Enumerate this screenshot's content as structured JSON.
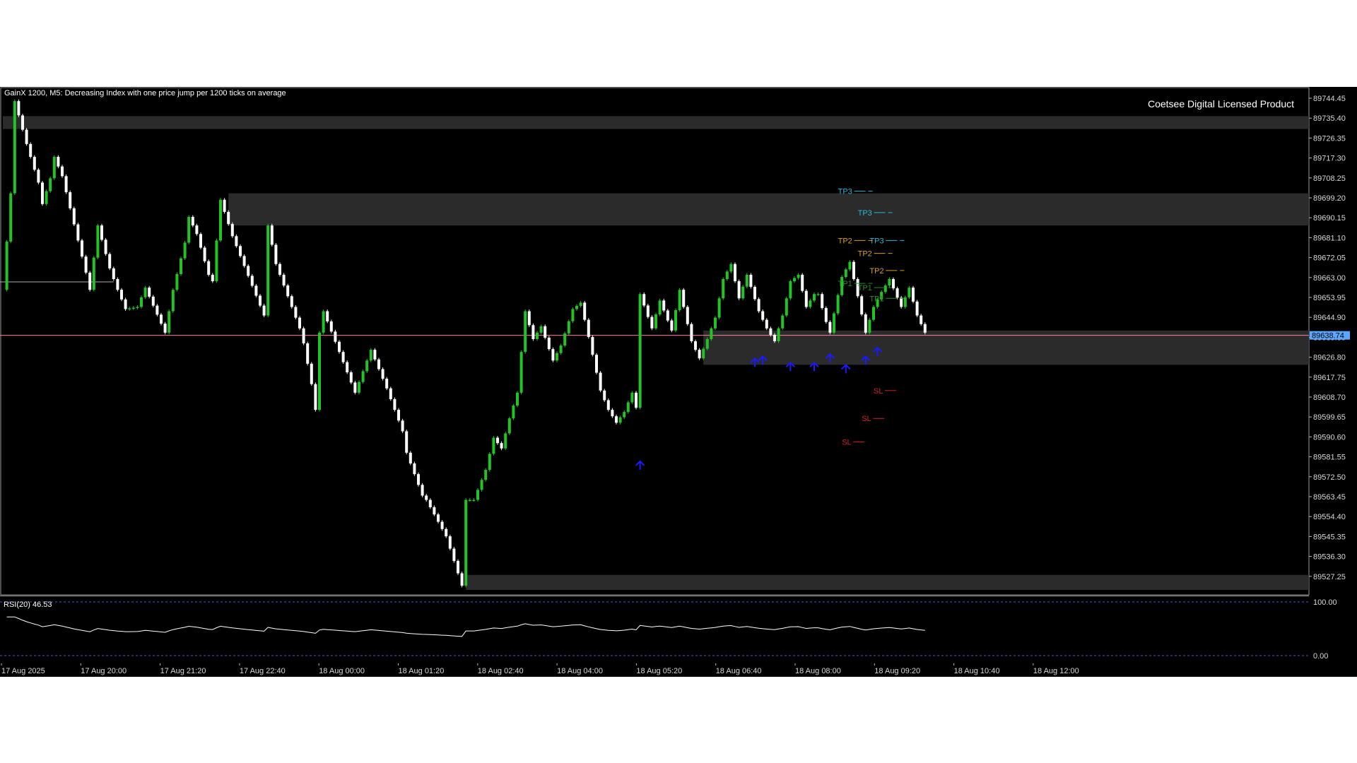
{
  "window": {
    "title": "GainX 1200, M5:  Decreasing Index with one price jump per 1200 ticks on average",
    "watermark": "Coetsee Digital Licensed Product"
  },
  "colors": {
    "background": "#000000",
    "bull_candle": "#22c322",
    "bear_candle": "#ffffff",
    "bid_line": "#ff7f9f",
    "price_tag": "#5aa7ff",
    "zone_fill": "#303030",
    "arrow": "#1a1aff",
    "tp3": "#27b9d8",
    "tp2": "#d9a020",
    "tp1": "#2a8a2a",
    "sl": "#d02020",
    "rsi_line": "#ffffff",
    "rsi_level": "#3f5fc8"
  },
  "price_axis": {
    "labels": [
      "89744.45",
      "89735.40",
      "89726.35",
      "89717.30",
      "89708.25",
      "89699.20",
      "89690.15",
      "89681.10",
      "89672.05",
      "89663.00",
      "89653.95",
      "89644.90",
      "89635.85",
      "89626.80",
      "89617.75",
      "89608.70",
      "89599.65",
      "89590.60",
      "89581.55",
      "89572.50",
      "89563.45",
      "89554.40",
      "89545.35",
      "89536.30",
      "89527.25"
    ],
    "current_price": "89638.74"
  },
  "rsi": {
    "title": "RSI(20) 46.53",
    "levels": [
      "100.00",
      "0.00"
    ]
  },
  "time_axis": {
    "labels": [
      "17 Aug 2025",
      "17 Aug 20:00",
      "17 Aug 21:20",
      "17 Aug 22:40",
      "18 Aug 00:00",
      "18 Aug 01:20",
      "18 Aug 02:40",
      "18 Aug 04:00",
      "18 Aug 05:20",
      "18 Aug 06:40",
      "18 Aug 08:00",
      "18 Aug 09:20",
      "18 Aug 10:40",
      "18 Aug 12:00"
    ]
  },
  "chart_data": {
    "type": "candlestick",
    "symbol": "GainX 1200",
    "timeframe": "M5",
    "price_range": [
      89520,
      89752
    ],
    "candle_count": 158,
    "anchors": [
      [
        0,
        89660
      ],
      [
        2,
        89705
      ],
      [
        3,
        89748
      ],
      [
        6,
        89728
      ],
      [
        9,
        89710
      ],
      [
        10,
        89700
      ],
      [
        12,
        89712
      ],
      [
        13,
        89722
      ],
      [
        15,
        89713
      ],
      [
        21,
        89668
      ],
      [
        22,
        89660
      ],
      [
        24,
        89690
      ],
      [
        27,
        89670
      ],
      [
        29,
        89660
      ],
      [
        31,
        89651
      ],
      [
        34,
        89652
      ],
      [
        36,
        89661
      ],
      [
        41,
        89640
      ],
      [
        43,
        89660
      ],
      [
        46,
        89682
      ],
      [
        47,
        89694
      ],
      [
        49,
        89686
      ],
      [
        52,
        89667
      ],
      [
        53,
        89664
      ],
      [
        55,
        89702
      ],
      [
        58,
        89685
      ],
      [
        66,
        89648
      ],
      [
        67,
        89690
      ],
      [
        69,
        89672
      ],
      [
        75,
        89642
      ],
      [
        76,
        89635
      ],
      [
        78,
        89616
      ],
      [
        79,
        89604
      ],
      [
        80,
        89640
      ],
      [
        81,
        89650
      ],
      [
        89,
        89612
      ],
      [
        93,
        89632
      ],
      [
        97,
        89614
      ],
      [
        101,
        89594
      ],
      [
        102,
        89584
      ],
      [
        106,
        89564
      ],
      [
        107,
        89562
      ],
      [
        112,
        89545
      ],
      [
        116,
        89522
      ],
      [
        117,
        89562
      ],
      [
        119,
        89562
      ],
      [
        122,
        89576
      ],
      [
        124,
        89591
      ],
      [
        126,
        89586
      ],
      [
        128,
        89600
      ],
      [
        130,
        89612
      ],
      [
        132,
        89650
      ],
      [
        134,
        89637
      ],
      [
        136,
        89643
      ],
      [
        139,
        89627
      ],
      [
        141,
        89634
      ],
      [
        144,
        89651
      ],
      [
        146,
        89654
      ],
      [
        148,
        89638
      ],
      [
        151,
        89613
      ],
      [
        153,
        89604
      ],
      [
        155,
        89598
      ],
      [
        157,
        89603
      ],
      [
        159,
        89612
      ],
      [
        160,
        89605
      ],
      [
        161,
        89658
      ],
      [
        164,
        89642
      ],
      [
        166,
        89655
      ],
      [
        169,
        89641
      ],
      [
        171,
        89660
      ],
      [
        174,
        89636
      ],
      [
        176,
        89628
      ],
      [
        178,
        89637
      ],
      [
        180,
        89647
      ],
      [
        182,
        89665
      ],
      [
        184,
        89672
      ],
      [
        186,
        89656
      ],
      [
        188,
        89667
      ],
      [
        191,
        89650
      ],
      [
        193,
        89642
      ],
      [
        195,
        89636
      ],
      [
        197,
        89648
      ],
      [
        199,
        89664
      ],
      [
        201,
        89667
      ],
      [
        203,
        89652
      ],
      [
        205,
        89658
      ],
      [
        206,
        89658
      ],
      [
        208,
        89645
      ],
      [
        209,
        89640
      ],
      [
        210,
        89649
      ],
      [
        212,
        89666
      ],
      [
        214,
        89673
      ],
      [
        216,
        89657
      ],
      [
        218,
        89640
      ],
      [
        220,
        89652
      ],
      [
        222,
        89659
      ],
      [
        224,
        89665
      ],
      [
        227,
        89652
      ],
      [
        229,
        89661
      ],
      [
        231,
        89648
      ],
      [
        233,
        89640
      ]
    ],
    "zones": [
      {
        "from_index": 0,
        "price_top": 89741,
        "price_bottom": 89735
      },
      {
        "from_index": 57,
        "price_top": 89705,
        "price_bottom": 89690
      },
      {
        "from_index": 177,
        "price_top": 89641,
        "price_bottom": 89625
      },
      {
        "from_index": 117,
        "price_top": 89527,
        "price_bottom": 89520
      }
    ],
    "horizontal_lines": [
      {
        "price": 89663.7,
        "to_index": 28
      },
      {
        "price": 89638.74
      }
    ],
    "buy_arrows": [
      {
        "index": 161,
        "price": 89580
      },
      {
        "index": 190,
        "price": 89628
      },
      {
        "index": 192,
        "price": 89629
      },
      {
        "index": 199,
        "price": 89626
      },
      {
        "index": 205,
        "price": 89626
      },
      {
        "index": 209,
        "price": 89630
      },
      {
        "index": 213,
        "price": 89625
      },
      {
        "index": 218,
        "price": 89629
      },
      {
        "index": 221,
        "price": 89633
      }
    ],
    "target_labels": [
      {
        "text": "TP3",
        "kind": "tp3",
        "price": 89706,
        "index": 211
      },
      {
        "text": "TP3",
        "kind": "tp3",
        "price": 89696,
        "index": 216
      },
      {
        "text": "TP3",
        "kind": "tp3",
        "price": 89683,
        "index": 219
      },
      {
        "text": "TP2",
        "kind": "tp2",
        "price": 89683,
        "index": 211
      },
      {
        "text": "TP2",
        "kind": "tp2",
        "price": 89677,
        "index": 216
      },
      {
        "text": "TP2",
        "kind": "tp2",
        "price": 89669,
        "index": 219
      },
      {
        "text": "TP1",
        "kind": "tp1",
        "price": 89663,
        "index": 211
      },
      {
        "text": "TP1",
        "kind": "tp1",
        "price": 89661,
        "index": 216
      },
      {
        "text": "TP1",
        "kind": "tp1",
        "price": 89656,
        "index": 219
      },
      {
        "text": "SL",
        "kind": "sl",
        "price": 89613,
        "index": 220
      },
      {
        "text": "SL",
        "kind": "sl",
        "price": 89600,
        "index": 217
      },
      {
        "text": "SL",
        "kind": "sl",
        "price": 89589,
        "index": 212
      }
    ]
  }
}
